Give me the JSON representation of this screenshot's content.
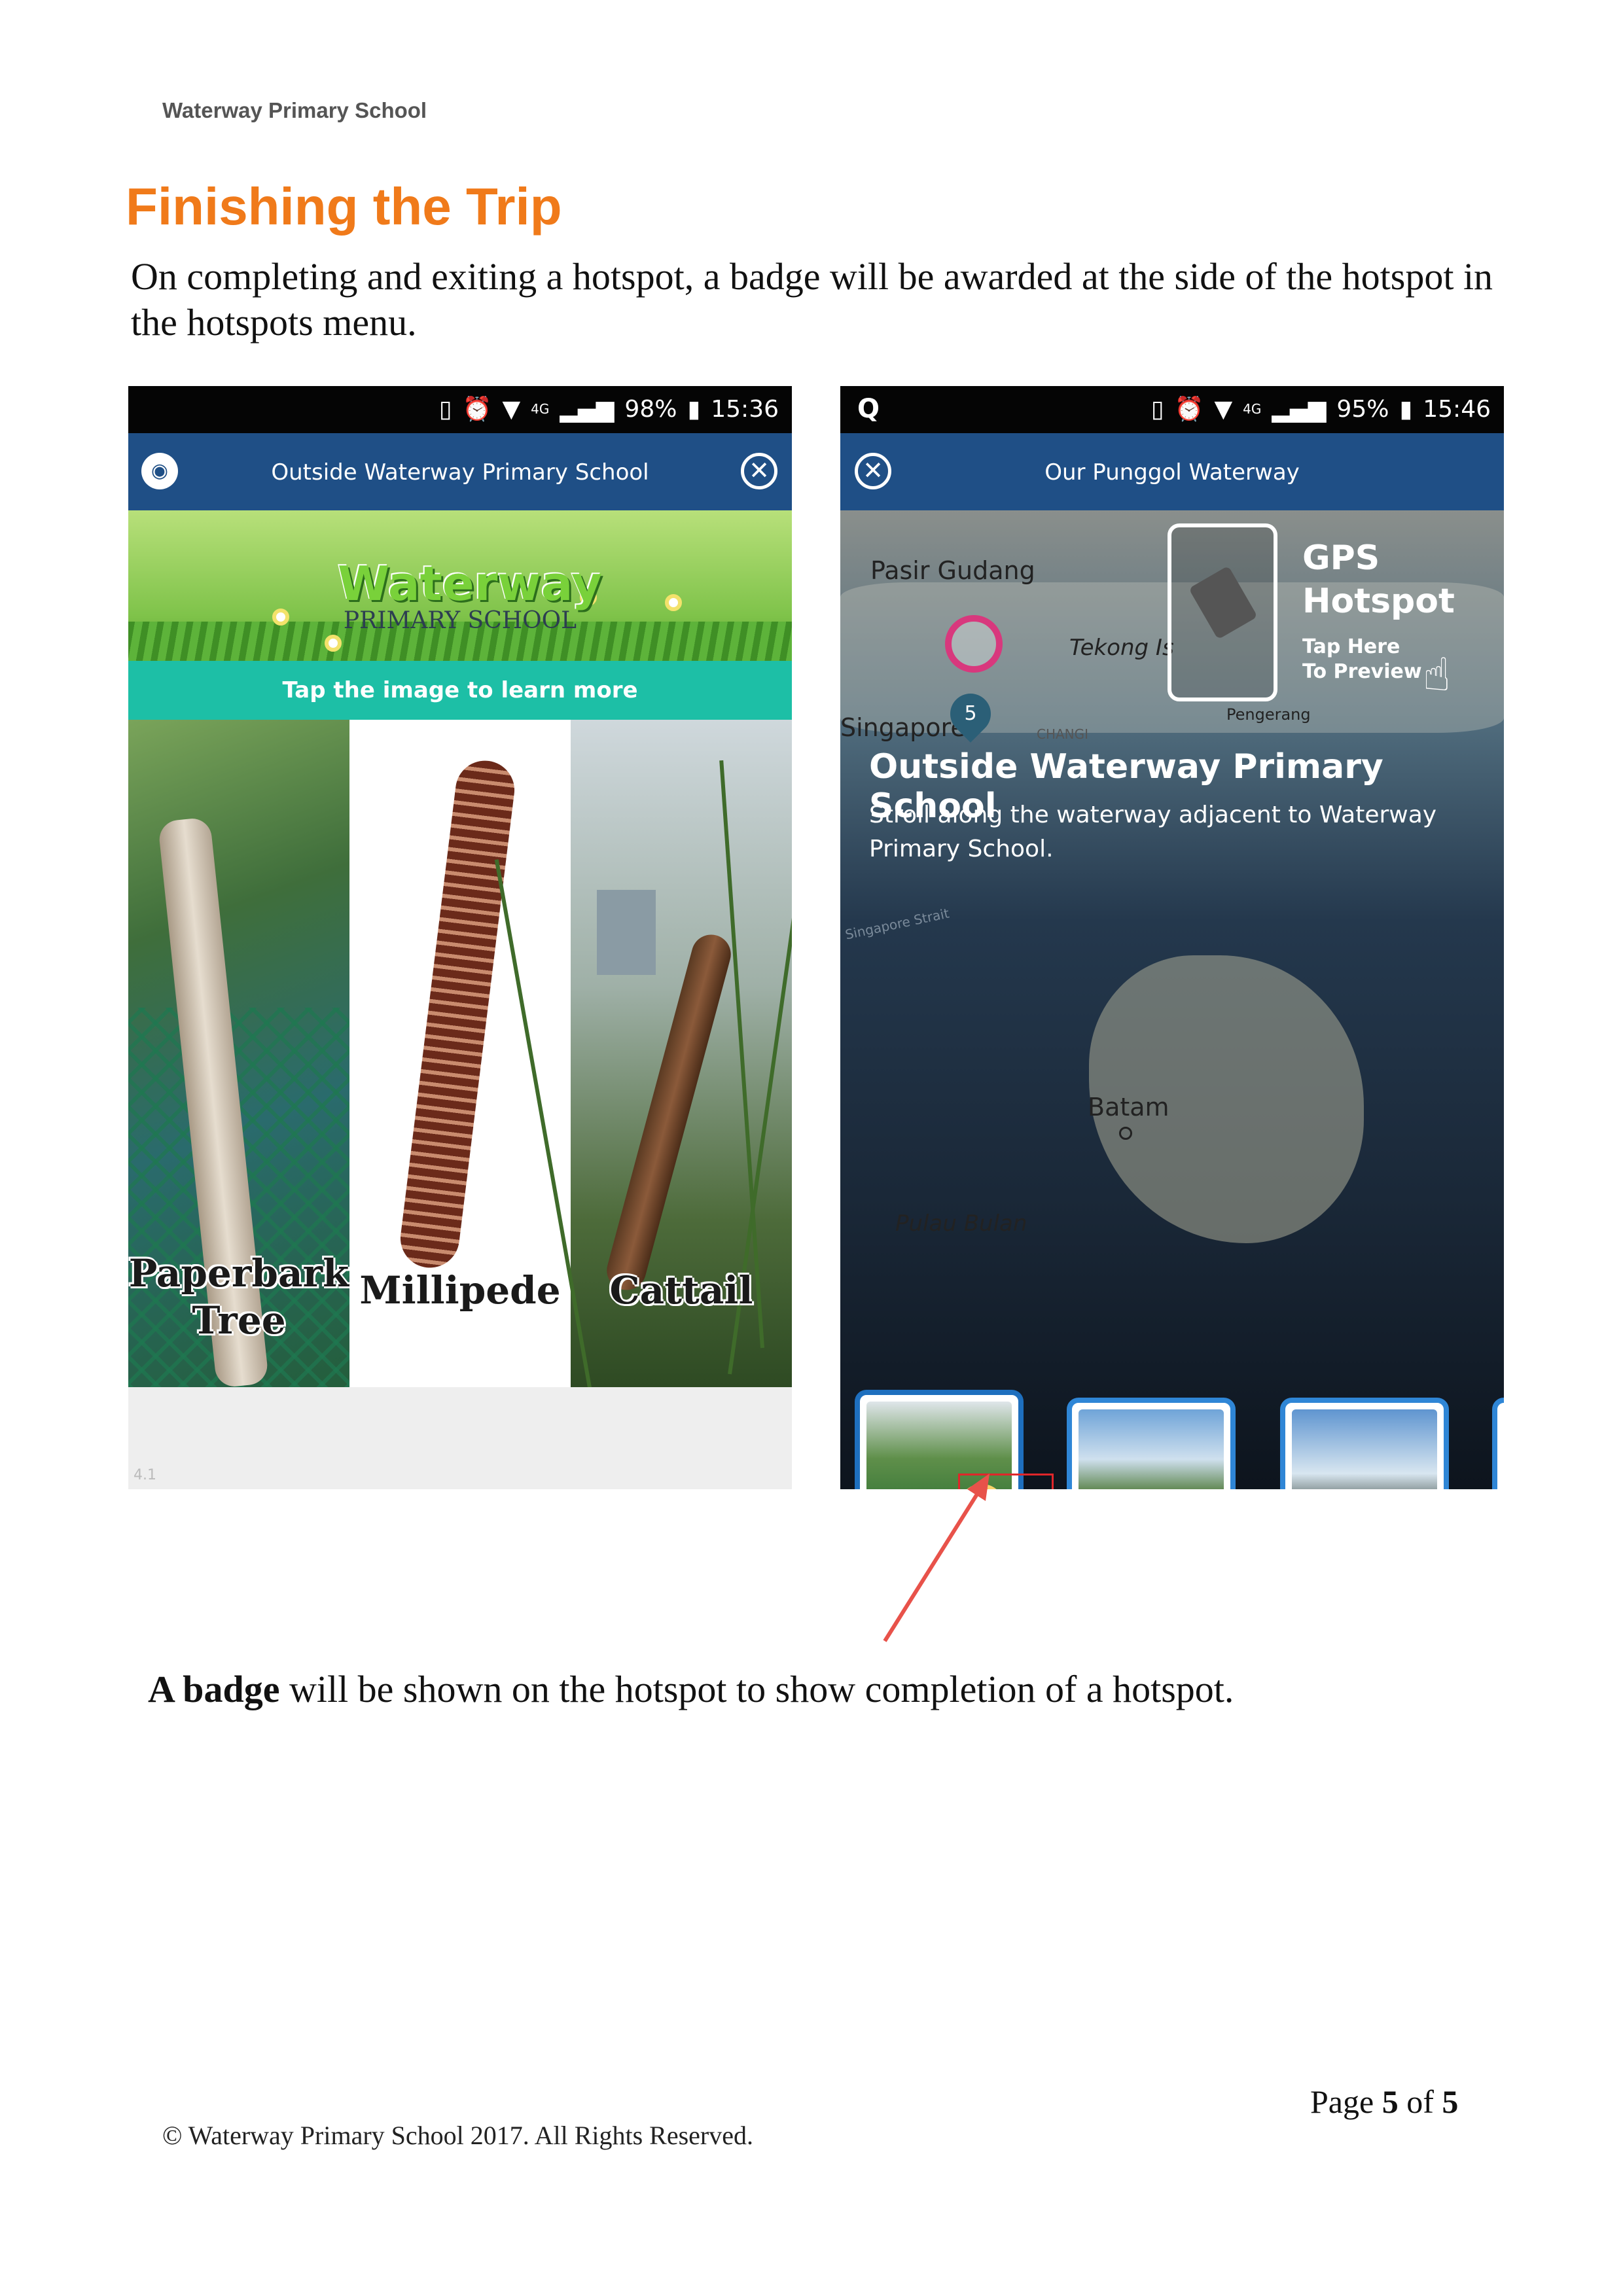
{
  "header": {
    "school": "Waterway Primary School"
  },
  "section": {
    "title": "Finishing the Trip",
    "intro": "On completing and exiting a hotspot, a badge will be awarded at the side of the hotspot in the hotspots menu."
  },
  "phone1": {
    "status": {
      "battery": "98%",
      "time": "15:36",
      "network": "4G"
    },
    "title": "Outside Waterway Primary School",
    "icons": {
      "left": "camera-icon",
      "right": "close-icon"
    },
    "banner": {
      "logo_word": "Waterway",
      "logo_sub": "PRIMARY SCHOOL"
    },
    "tap_hint": "Tap the image to learn more",
    "panels": [
      {
        "label": "Paperbark Tree"
      },
      {
        "label": "Millipede"
      },
      {
        "label": "Cattail"
      }
    ],
    "version": "4.1"
  },
  "phone2": {
    "status": {
      "battery": "95%",
      "time": "15:46",
      "network": "4G"
    },
    "title": "Our Punggol Waterway",
    "icons": {
      "left": "close-icon"
    },
    "map_labels": {
      "pasir_gudang": "Pasir Gudang",
      "tekong": "Tekong Is",
      "singapore": "Singapore",
      "pengerang": "Pengerang",
      "changi": "CHANGI",
      "batam": "Batam",
      "pulau_bulan": "Pulau Bulan",
      "strait": "Singapore Strait"
    },
    "pin_number": "5",
    "gps": {
      "title_line1": "GPS",
      "title_line2": "Hotspot",
      "tap_line1": "Tap Here",
      "tap_line2": "To Preview"
    },
    "hotspot": {
      "title": "Outside Waterway Primary School",
      "description": "Stroll along the waterway adjacent to Waterway Primary School."
    }
  },
  "caption": {
    "bold": "A badge",
    "rest": " will be shown on the hotspot to show completion of a hotspot."
  },
  "footer": {
    "page_prefix": "Page ",
    "page_current": "5",
    "page_of": " of ",
    "page_total": "5",
    "copyright": "© Waterway Primary School 2017. All Rights Reserved."
  },
  "colors": {
    "title": "#f07a1a",
    "appbar": "#1f4f86",
    "tapbar": "#1dbfa6",
    "arrow": "#e8524a",
    "badge_box": "#e0262a"
  }
}
